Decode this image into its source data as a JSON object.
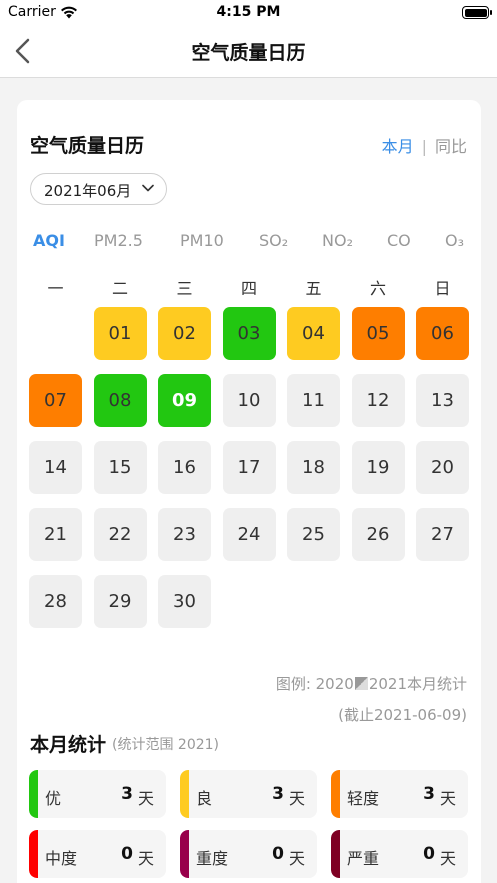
{
  "status_bar": {
    "carrier": "Carrier",
    "time": "4:15 PM"
  },
  "nav": {
    "title": "空气质量日历"
  },
  "card": {
    "title": "空气质量日历",
    "toggle": {
      "current": "本月",
      "separator": "|",
      "compare": "同比"
    },
    "month": "2021年06月"
  },
  "tabs": [
    {
      "label": "AQI",
      "active": true
    },
    {
      "label": "PM2.5"
    },
    {
      "label": "PM10"
    },
    {
      "label": "SO₂"
    },
    {
      "label": "NO₂"
    },
    {
      "label": "CO"
    },
    {
      "label": "O₃"
    }
  ],
  "weekdays": [
    "一",
    "二",
    "三",
    "四",
    "五",
    "六",
    "日"
  ],
  "calendar": {
    "first_weekday_index": 1,
    "today": "09",
    "days": [
      {
        "d": "01",
        "level": "good"
      },
      {
        "d": "02",
        "level": "good"
      },
      {
        "d": "03",
        "level": "excellent"
      },
      {
        "d": "04",
        "level": "good"
      },
      {
        "d": "05",
        "level": "light"
      },
      {
        "d": "06",
        "level": "light"
      },
      {
        "d": "07",
        "level": "light"
      },
      {
        "d": "08",
        "level": "excellent"
      },
      {
        "d": "09",
        "level": "excellent"
      },
      {
        "d": "10",
        "level": "none"
      },
      {
        "d": "11",
        "level": "none"
      },
      {
        "d": "12",
        "level": "none"
      },
      {
        "d": "13",
        "level": "none"
      },
      {
        "d": "14",
        "level": "none"
      },
      {
        "d": "15",
        "level": "none"
      },
      {
        "d": "16",
        "level": "none"
      },
      {
        "d": "17",
        "level": "none"
      },
      {
        "d": "18",
        "level": "none"
      },
      {
        "d": "19",
        "level": "none"
      },
      {
        "d": "20",
        "level": "none"
      },
      {
        "d": "21",
        "level": "none"
      },
      {
        "d": "22",
        "level": "none"
      },
      {
        "d": "23",
        "level": "none"
      },
      {
        "d": "24",
        "level": "none"
      },
      {
        "d": "25",
        "level": "none"
      },
      {
        "d": "26",
        "level": "none"
      },
      {
        "d": "27",
        "level": "none"
      },
      {
        "d": "28",
        "level": "none"
      },
      {
        "d": "29",
        "level": "none"
      },
      {
        "d": "30",
        "level": "none"
      }
    ]
  },
  "legend": {
    "prefix": "图例: 2020",
    "suffix": "2021本月统计",
    "cutoff": "(截止2021-06-09)"
  },
  "stats": {
    "title": "本月统计",
    "range": "(统计范围 2021)",
    "items": [
      {
        "label": "优",
        "value": "3",
        "unit": "天",
        "color": "#22c711"
      },
      {
        "label": "良",
        "value": "3",
        "unit": "天",
        "color": "#fecb21"
      },
      {
        "label": "轻度",
        "value": "3",
        "unit": "天",
        "color": "#fe7e00"
      },
      {
        "label": "中度",
        "value": "0",
        "unit": "天",
        "color": "#fe0000"
      },
      {
        "label": "重度",
        "value": "0",
        "unit": "天",
        "color": "#98004b"
      },
      {
        "label": "严重",
        "value": "0",
        "unit": "天",
        "color": "#7e0023"
      }
    ]
  }
}
